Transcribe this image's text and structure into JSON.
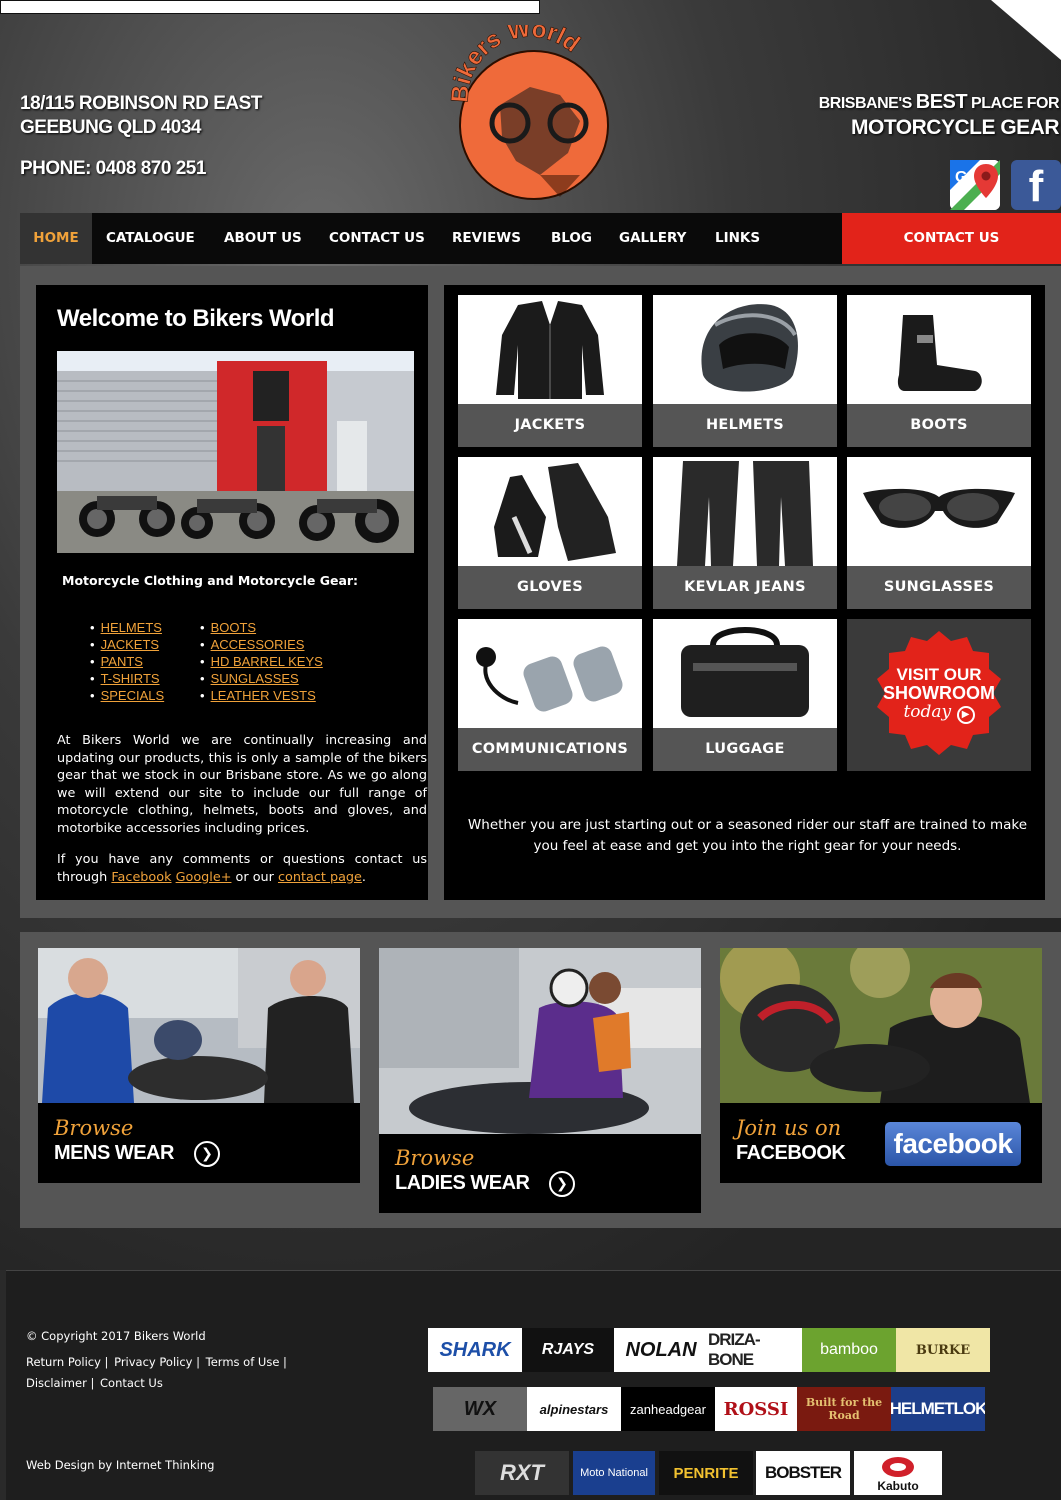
{
  "header": {
    "address_line1": "18/115 ROBINSON RD EAST",
    "address_line2": "GEEBUNG QLD 4034",
    "phone": "PHONE: 0408 870 251",
    "tagline_pre": "BRISBANE'S",
    "tagline_best": "BEST",
    "tagline_post": "PLACE FOR",
    "tagline_line2": "MOTORCYCLE GEAR",
    "logo_text": "Bikers World",
    "facebook_glyph": "f"
  },
  "nav": {
    "items": [
      "HOME",
      "CATALOGUE",
      "ABOUT US",
      "CONTACT US",
      "REVIEWS",
      "BLOG",
      "GALLERY",
      "LINKS"
    ],
    "contact_button": "CONTACT US"
  },
  "welcome": {
    "title": "Welcome to Bikers World",
    "gear_heading": "Motorcycle Clothing and Motorcycle Gear:",
    "links_col1": [
      "HELMETS",
      "JACKETS",
      "PANTS",
      "T-SHIRTS",
      "SPECIALS"
    ],
    "links_col2": [
      "BOOTS",
      "ACCESSORIES",
      "HD BARREL KEYS",
      "SUNGLASSES",
      "LEATHER VESTS"
    ],
    "para1": "At Bikers World we are continually increasing and updating our products, this is only a sample of the bikers gear that we stock in our Brisbane store. As we go along we will extend our site to include our full range of motorcycle clothing, helmets, boots and gloves, and motorbike accessories including prices.",
    "para2_pre": "If you have any comments or questions contact us through",
    "para2_link1": "Facebook",
    "para2_link2": "Google+",
    "para2_mid": "or our",
    "para2_link3": "contact page",
    "para2_end": "."
  },
  "catalogue": {
    "tiles": [
      "JACKETS",
      "HELMETS",
      "BOOTS",
      "GLOVES",
      "KEVLAR JEANS",
      "SUNGLASSES",
      "COMMUNICATIONS",
      "LUGGAGE"
    ],
    "showroom_line1": "VISIT OUR",
    "showroom_line2": "SHOWROOM",
    "showroom_line3": "today",
    "intro": "Whether you are just starting out or a seasoned rider our staff are trained to make you feel at ease and get you into the right gear for your needs."
  },
  "promos": {
    "mens": {
      "browse": "Browse",
      "title": "MENS WEAR"
    },
    "ladies": {
      "browse": "Browse",
      "title": "LADIES WEAR"
    },
    "facebook": {
      "browse": "Join us on",
      "title": "FACEBOOK",
      "button": "facebook"
    }
  },
  "footer": {
    "copyright": "© Copyright 2017 Bikers World",
    "links_row1": [
      "Return Policy |",
      "Privacy Policy |",
      "Terms of Use |"
    ],
    "links_row2": [
      "Disclaimer |",
      "Contact Us"
    ],
    "credit": "Web Design by Internet Thinking",
    "brands_row1": [
      "SHARK",
      "RJAYS",
      "NOLAN",
      "DRIZA-BONE",
      "bamboo",
      "BURKE"
    ],
    "brands_row2": [
      "WX",
      "alpinestars",
      "zanheadgear",
      "ROSSI",
      "Built for the Road",
      "HELMETLOK"
    ],
    "brands_row3": [
      "RXT",
      "Moto National",
      "PENRITE",
      "BOBSTER",
      "Kabuto"
    ]
  },
  "colors": {
    "accent_orange": "#f0a23a",
    "contact_red": "#e2231a",
    "facebook_blue": "#3b5998",
    "logo_orange": "#ef6a3a"
  }
}
